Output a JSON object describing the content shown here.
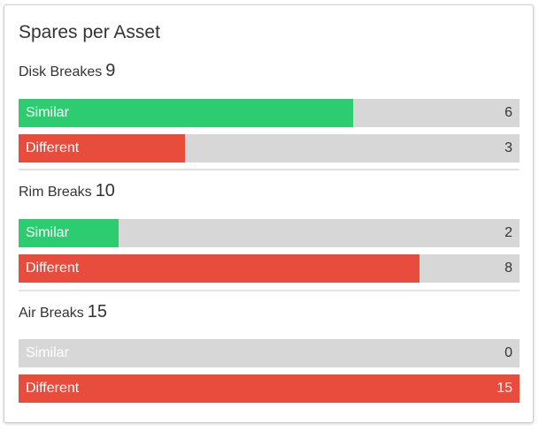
{
  "panel": {
    "title": "Spares per Asset"
  },
  "colors": {
    "similar": "#2ecc71",
    "different": "#e74c3c",
    "track": "#d7d7d7"
  },
  "sections": [
    {
      "name": "Disk Breakes",
      "total": "9",
      "bars": [
        {
          "label": "Similar",
          "value": "6",
          "fraction": 0.667,
          "color_key": "similar"
        },
        {
          "label": "Different",
          "value": "3",
          "fraction": 0.333,
          "color_key": "different"
        }
      ]
    },
    {
      "name": "Rim Breaks",
      "total": "10",
      "bars": [
        {
          "label": "Similar",
          "value": "2",
          "fraction": 0.2,
          "color_key": "similar"
        },
        {
          "label": "Different",
          "value": "8",
          "fraction": 0.8,
          "color_key": "different"
        }
      ]
    },
    {
      "name": "Air Breaks",
      "total": "15",
      "bars": [
        {
          "label": "Similar",
          "value": "0",
          "fraction": 0.0,
          "color_key": "similar"
        },
        {
          "label": "Different",
          "value": "15",
          "fraction": 1.0,
          "color_key": "different"
        }
      ]
    }
  ]
}
